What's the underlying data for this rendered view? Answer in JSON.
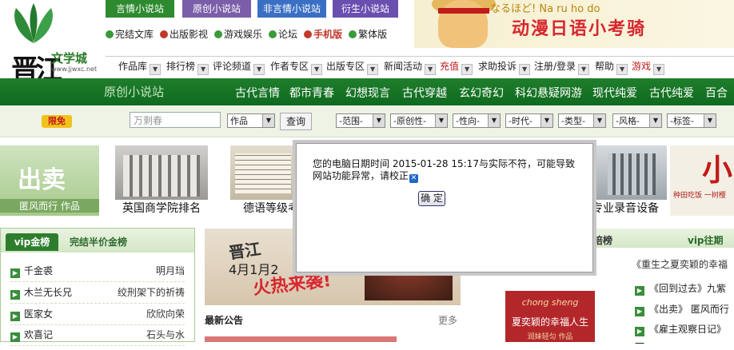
{
  "logo": {
    "brand": "晋江",
    "site_name": "文学城",
    "url": "www.jjwxc.net"
  },
  "site_tabs": [
    {
      "label": "言情小说站",
      "color": "#2e8a2e"
    },
    {
      "label": "原创小说站",
      "color": "#7b5ea8"
    },
    {
      "label": "非言情小说站",
      "color": "#3a6fc4"
    },
    {
      "label": "衍生小说站",
      "color": "#6a4fb0"
    }
  ],
  "quick_links": [
    {
      "label": "完结文库",
      "color": "#3a9a3a"
    },
    {
      "label": "出版影视",
      "color": "#c0392b"
    },
    {
      "label": "游戏娱乐",
      "color": "#3a9a3a"
    },
    {
      "label": "论坛",
      "color": "#3a9a3a"
    },
    {
      "label": "手机版",
      "color": "#c0392b"
    },
    {
      "label": "繁体版",
      "color": "#3a9a3a"
    }
  ],
  "banner": {
    "kana": "なるほど! Na ru ho do",
    "title": "动漫日语小考骑"
  },
  "main_nav": [
    "作品库",
    "排行榜",
    "评论频道",
    "作者专区",
    "出版专区",
    "新闻活动",
    "充值",
    "求助投诉",
    "注册/登录",
    "帮助",
    "游戏"
  ],
  "genre_bar": {
    "station": "原创小说站",
    "genres": [
      "古代言情",
      "都市青春",
      "幻想现言",
      "古代穿越",
      "玄幻奇幻",
      "科幻悬疑网游",
      "现代纯爱",
      "古代纯爱",
      "百合"
    ]
  },
  "search": {
    "badge": "限免",
    "keyword": "万剩春",
    "type_select": "作品",
    "search_button": "查询",
    "filters": [
      "-范围-",
      "-原创性-",
      "-性向-",
      "-时代-",
      "-类型-",
      "-风格-",
      "-标签-"
    ]
  },
  "tiles": [
    {
      "caption": "",
      "art_text": "出卖",
      "sub": "匿风而行 作品"
    },
    {
      "caption": "英国商学院排名"
    },
    {
      "caption": "德语等级考"
    },
    {
      "caption": "专业录音设备"
    },
    {
      "caption": "",
      "art_text": "小",
      "sub": "种田吃饭 一树樱"
    }
  ],
  "vip_panel": {
    "tabs": [
      "vip金榜",
      "完结半价金榜"
    ],
    "rows": [
      {
        "title": "千金裘",
        "author": "明月珰"
      },
      {
        "title": "木兰无长兄",
        "author": "绞刑架下的祈祷"
      },
      {
        "title": "医家女",
        "author": "欣欣向荣"
      },
      {
        "title": "欢喜记",
        "author": "石头与水"
      }
    ]
  },
  "poster": {
    "line1": "晋江",
    "line2": "4月1月2",
    "line3": "火热来袭!"
  },
  "notice": {
    "title": "最新公告",
    "more": "更多"
  },
  "right": {
    "title": "培榜",
    "vip_week": "vip往期",
    "quote": "《重生之夏奕颖的幸福",
    "items": [
      "《回到过去》九紫",
      "《出卖》 匿风而行",
      "《雇主观察日记》一"
    ],
    "book": {
      "kana": "chong sheng",
      "title": "夏奕颖的幸福人生",
      "author": "润妹轻匀  作品"
    }
  },
  "modal": {
    "message": "您的电脑日期时间 2015-01-28 15:17与实际不符，可能导致网站功能异常，请校正",
    "ok": "确 定"
  }
}
